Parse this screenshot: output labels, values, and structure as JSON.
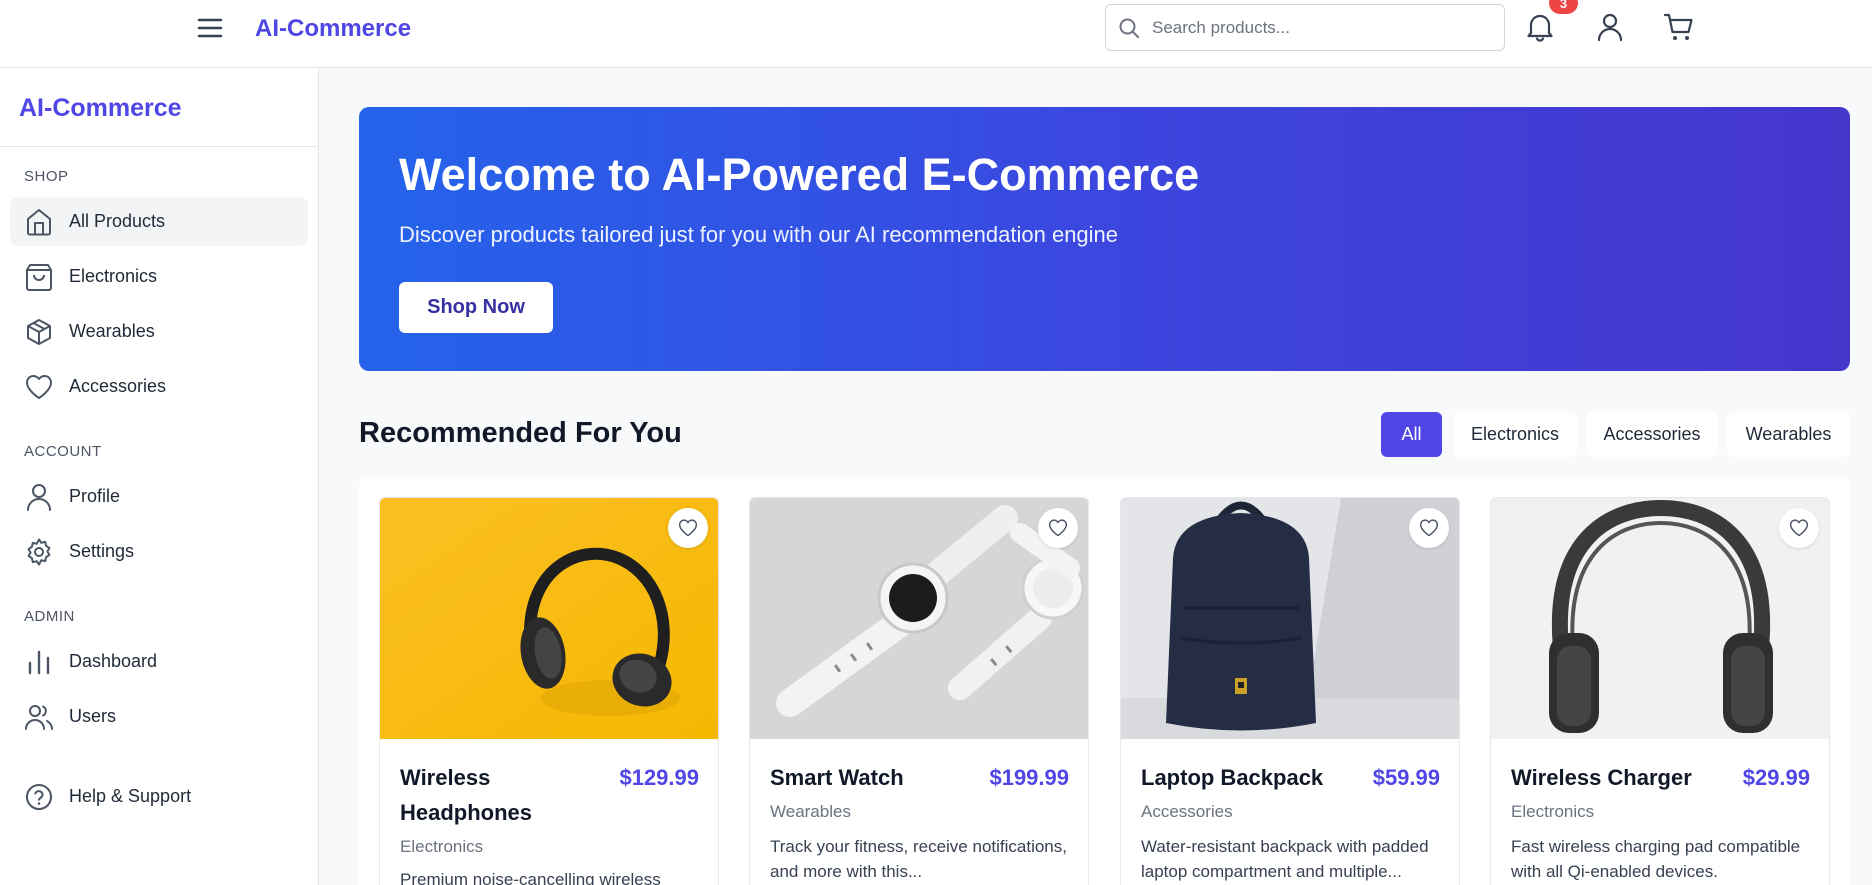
{
  "header": {
    "brand": "AI-Commerce",
    "search_placeholder": "Search products...",
    "notification_count": "3",
    "icons": [
      "menu-icon",
      "search-icon",
      "bell-icon",
      "user-icon",
      "cart-icon"
    ]
  },
  "sidebar": {
    "brand": "AI-Commerce",
    "sections": {
      "shop": "SHOP",
      "account": "ACCOUNT",
      "admin": "ADMIN"
    },
    "items": [
      {
        "label": "All Products",
        "icon": "home-icon"
      },
      {
        "label": "Electronics",
        "icon": "shopping-bag-icon"
      },
      {
        "label": "Wearables",
        "icon": "package-icon"
      },
      {
        "label": "Accessories",
        "icon": "heart-icon"
      },
      {
        "label": "Profile",
        "icon": "user-icon"
      },
      {
        "label": "Settings",
        "icon": "gear-icon"
      },
      {
        "label": "Dashboard",
        "icon": "bar-chart-icon"
      },
      {
        "label": "Users",
        "icon": "users-icon"
      },
      {
        "label": "Help & Support",
        "icon": "help-circle-icon"
      }
    ],
    "active": "All Products"
  },
  "hero": {
    "title": "Welcome to AI-Powered E-Commerce",
    "subtitle": "Discover products tailored just for you with our AI recommendation engine",
    "button": "Shop Now",
    "gradient_start": "#2563eb",
    "gradient_end": "#4536cc"
  },
  "recommended": {
    "title": "Recommended For You",
    "filters": [
      "All",
      "Electronics",
      "Accessories",
      "Wearables"
    ],
    "active_filter": "All",
    "products": [
      {
        "name": "Wireless Headphones",
        "price": "$129.99",
        "category": "Electronics",
        "description": "Premium noise-cancelling wireless",
        "image": "headphones-on-yellow"
      },
      {
        "name": "Smart Watch",
        "price": "$199.99",
        "category": "Wearables",
        "description": "Track your fitness, receive notifications, and more with this...",
        "image": "white-smart-watch"
      },
      {
        "name": "Laptop Backpack",
        "price": "$59.99",
        "category": "Accessories",
        "description": "Water-resistant backpack with padded laptop compartment and multiple...",
        "image": "navy-backpack"
      },
      {
        "name": "Wireless Charger",
        "price": "$29.99",
        "category": "Electronics",
        "description": "Fast wireless charging pad compatible with all Qi-enabled devices.",
        "image": "gray-headphones"
      }
    ]
  },
  "colors": {
    "accent": "#4f46e5",
    "badge": "#ef4444"
  }
}
